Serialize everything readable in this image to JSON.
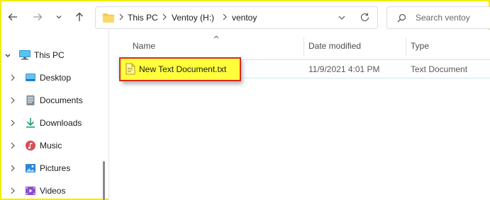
{
  "toolbar": {
    "back_icon": "back-arrow-icon",
    "forward_icon": "forward-arrow-icon",
    "recent_icon": "chevron-down-icon",
    "up_icon": "up-arrow-icon"
  },
  "address": {
    "crumbs": [
      "This PC",
      "Ventoy (H:)",
      "ventoy"
    ],
    "dropdown_icon": "chevron-down-icon",
    "refresh_icon": "refresh-icon"
  },
  "search": {
    "placeholder": "Search ventoy",
    "icon": "search-icon"
  },
  "nav": {
    "items": [
      {
        "label": "This PC",
        "icon": "computer-icon",
        "expanded": true
      },
      {
        "label": "Desktop",
        "icon": "desktop-icon"
      },
      {
        "label": "Documents",
        "icon": "documents-icon"
      },
      {
        "label": "Downloads",
        "icon": "downloads-icon"
      },
      {
        "label": "Music",
        "icon": "music-icon"
      },
      {
        "label": "Pictures",
        "icon": "pictures-icon"
      },
      {
        "label": "Videos",
        "icon": "videos-icon"
      }
    ]
  },
  "columns": {
    "name": "Name",
    "date": "Date modified",
    "type": "Type"
  },
  "files": [
    {
      "name": "New Text Document.txt",
      "date": "11/9/2021 4:01 PM",
      "type": "Text Document"
    }
  ],
  "colors": {
    "highlight_fill": "#ffff3b",
    "highlight_border": "#d52b1e",
    "frame_border": "#f2ec00"
  }
}
